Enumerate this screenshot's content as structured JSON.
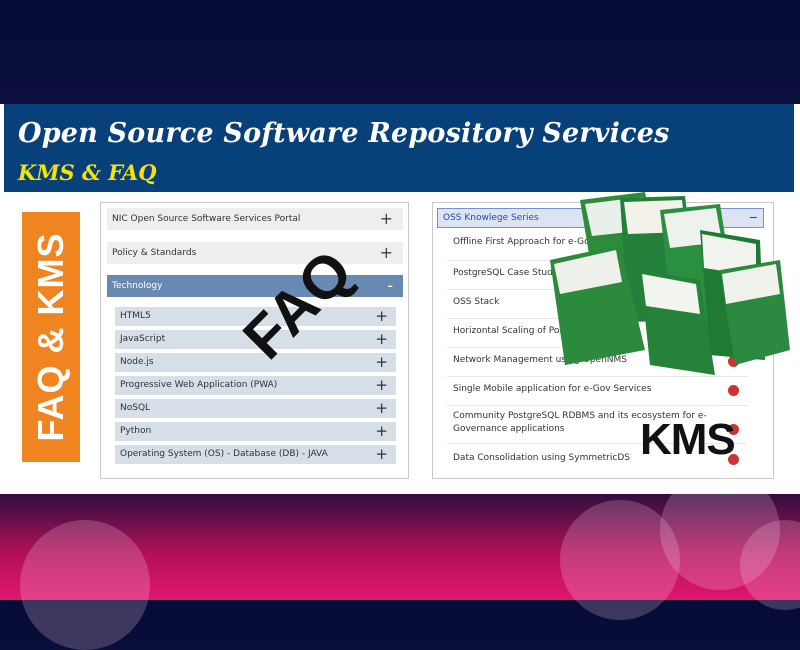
{
  "banner": {
    "title": "Open Source Software Repository Services",
    "subtitle": "KMS & FAQ"
  },
  "side_label": "FAQ & KMS",
  "faq_panel": {
    "accordions": [
      {
        "label": "NIC Open Source Software Services Portal",
        "sign": "+"
      },
      {
        "label": "Policy & Standards",
        "sign": "+"
      },
      {
        "label": "Technology",
        "sign": "-"
      }
    ],
    "technology_items": [
      {
        "label": "HTML5",
        "sign": "+"
      },
      {
        "label": "JavaScript",
        "sign": "+"
      },
      {
        "label": "Node.js",
        "sign": "+"
      },
      {
        "label": "Progressive Web Application (PWA)",
        "sign": "+"
      },
      {
        "label": "NoSQL",
        "sign": "+"
      },
      {
        "label": "Python",
        "sign": "+"
      },
      {
        "label": "Operating System (OS) - Database (DB) - JAVA",
        "sign": "+"
      }
    ]
  },
  "kms_panel": {
    "header": "OSS Knowlege Series",
    "header_sign": "−",
    "items": [
      "Offline First Approach for e-Govern App Development",
      "PostgreSQL Case Study",
      "OSS Stack",
      "Horizontal Scaling of PostgreSQL",
      "Network Management using OpenNMS",
      "Single Mobile application for e-Gov Services",
      "Community PostgreSQL RDBMS and its ecosystem for e-Governance applications",
      "Data Consolidation using SymmetricDS"
    ]
  },
  "overlays": {
    "faq": "FAQ",
    "kms": "KMS"
  },
  "colors": {
    "banner_bg": "#08407a",
    "subtitle": "#f4e20a",
    "side_label_bg": "#f08420",
    "active_accordion": "#6889b4"
  }
}
